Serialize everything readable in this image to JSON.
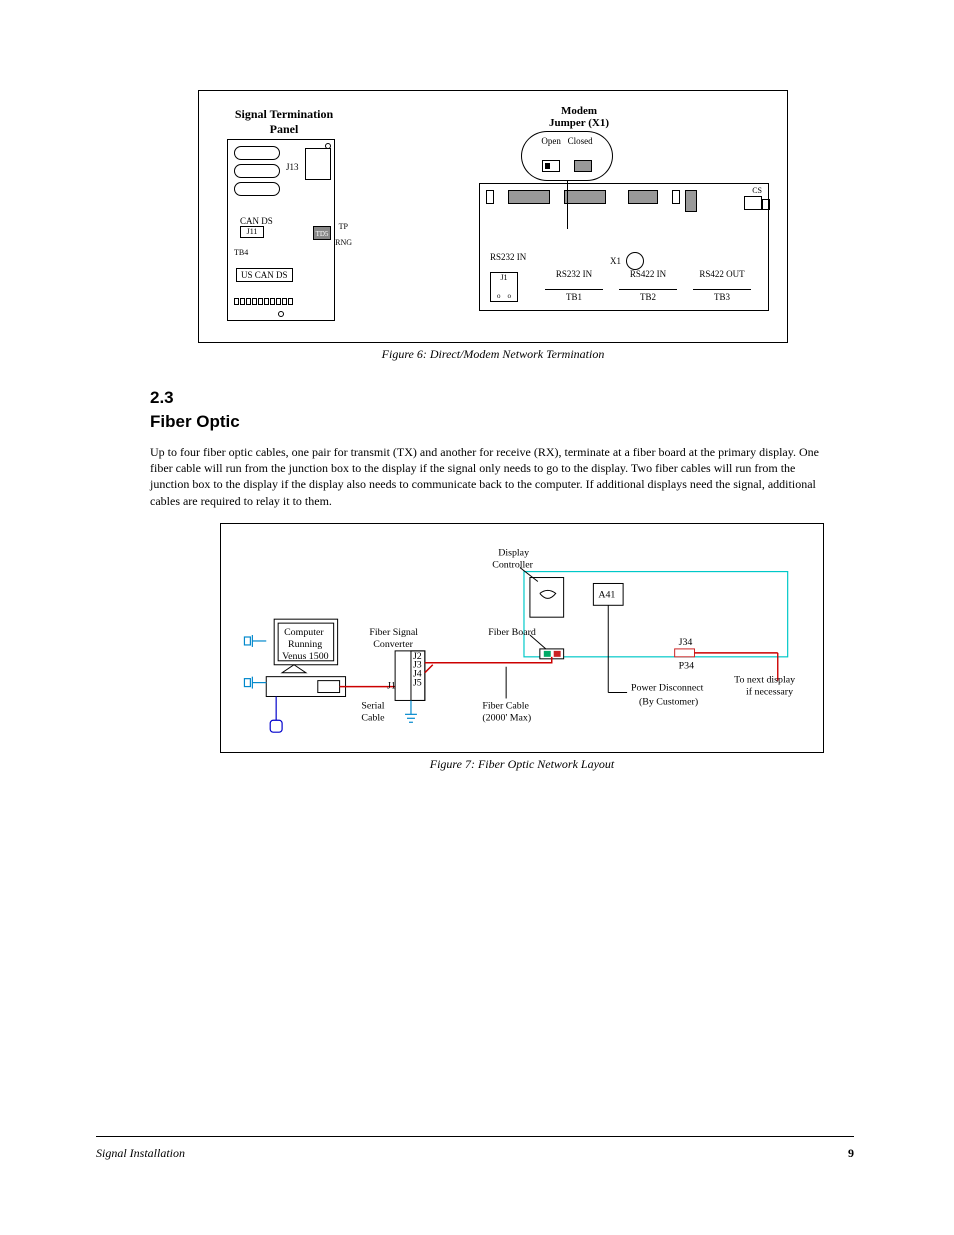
{
  "fig1": {
    "panel_title_l1": "Signal Termination",
    "panel_title_l2": "Panel",
    "modem_l1": "Modem",
    "modem_l2": "Jumper (X1)",
    "open": "Open",
    "closed": "Closed",
    "j13": "J13",
    "cands": "CAN DS",
    "j11": "J11",
    "td5": "TD5",
    "tp": "TP",
    "rng": "RNG",
    "tb4": "TB4",
    "us_can_ds": "US  CAN  DS",
    "rs232_in_top": "RS232 IN",
    "j1": "J1",
    "x1": "X1",
    "cs": "CS",
    "rs232_in": "RS232 IN",
    "rs422_in": "RS422 IN",
    "rs422_out": "RS422 OUT",
    "tb1": "TB1",
    "tb2": "TB2",
    "tb3": "TB3",
    "caption": "Figure 6: Direct/Modem Network Termination"
  },
  "section": {
    "num": "2.3",
    "head": "Fiber Optic"
  },
  "para": "Up to four fiber optic cables, one pair for transmit (TX) and another for receive (RX), terminate at a fiber board at the primary display. One fiber cable will run from the junction box to the display if the signal only needs to go to the display. Two fiber cables will run from the junction box to the display if the display also needs to communicate back to the computer. If additional displays need the signal, additional cables are required to relay it to them.",
  "fig2": {
    "computer_l1": "Computer",
    "computer_l2": "Running",
    "computer_l3": "Venus 1500",
    "fsc_l1": "Fiber Signal",
    "fsc_l2": "Converter",
    "j1": "J1",
    "j2": "J2",
    "j3": "J3",
    "j4": "J4",
    "j5": "J5",
    "serial_l1": "Serial",
    "serial_l2": "Cable",
    "fiber_l1": "Fiber Cable",
    "fiber_l2": "(2000' Max)",
    "display_l1": "Display",
    "display_l2": "Controller",
    "fiber_board": "Fiber Board",
    "a41": "A41",
    "power_l1": "Power Disconnect",
    "power_l2": "(By Customer)",
    "j34": "J34",
    "p34": "P34",
    "next_l1": "To next display",
    "next_l2": "if necessary",
    "caption": "Figure 7: Fiber Optic Network Layout"
  },
  "footer": {
    "left": "Signal Installation",
    "right": "9"
  }
}
